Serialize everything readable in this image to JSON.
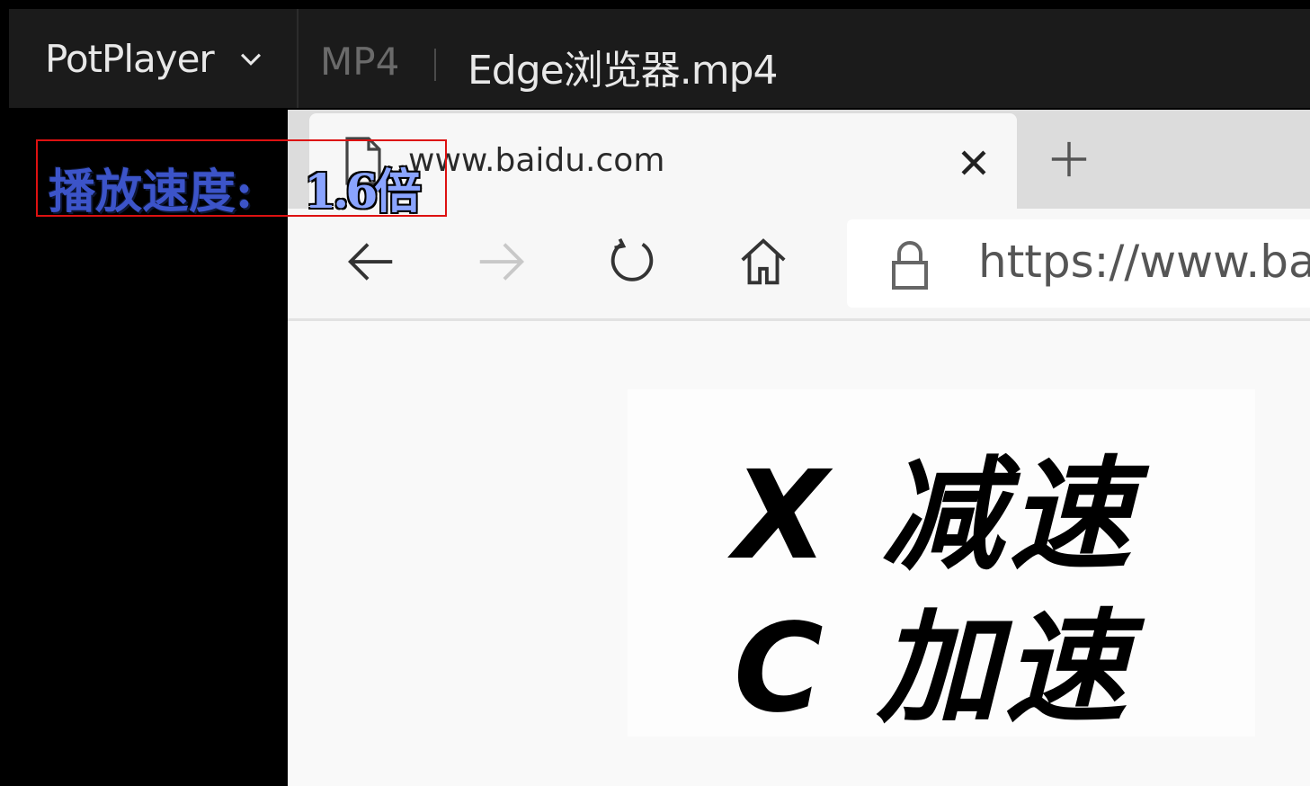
{
  "player": {
    "app_name": "PotPlayer",
    "format": "MP4",
    "filename": "Edge浏览器.mp4"
  },
  "osd": {
    "speed_label": "播放速度:",
    "speed_value": "1.6倍"
  },
  "browser": {
    "tab_title": "www.baidu.com",
    "url": "https://www.baidu.com",
    "icons": [
      "page-icon",
      "close-icon",
      "plus-icon",
      "back-arrow-icon",
      "forward-arrow-icon",
      "refresh-icon",
      "home-icon",
      "lock-icon"
    ]
  },
  "hints": {
    "slow_down": "X 减速",
    "speed_up": "C 加速"
  }
}
